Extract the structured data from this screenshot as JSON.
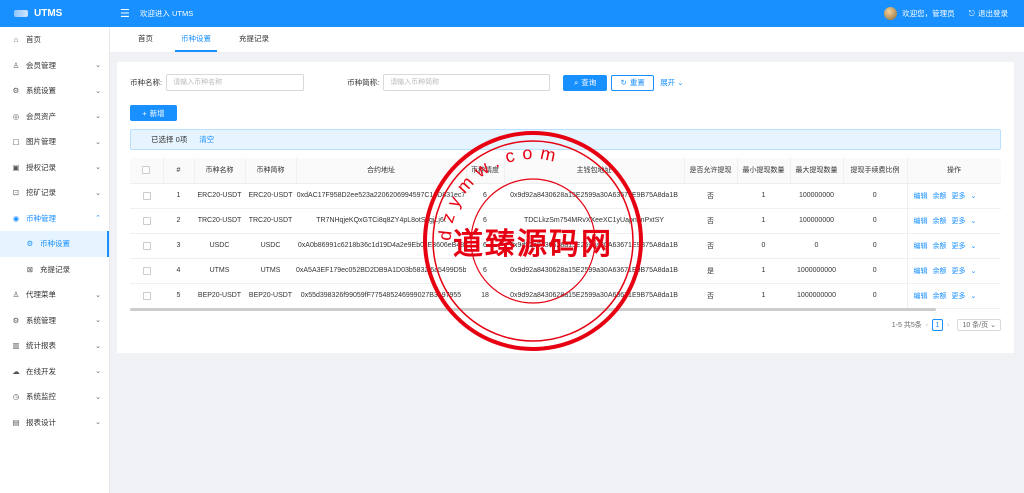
{
  "app": {
    "name": "UTMS",
    "welcome": "欢迎进入 UTMS"
  },
  "user": {
    "greeting": "欢迎您，管理员",
    "logout": "退出登录"
  },
  "sidebar": {
    "items": [
      {
        "label": "首页",
        "icon": "home-icon",
        "glyph": "⌂",
        "arrow": ""
      },
      {
        "label": "会员管理",
        "icon": "user-icon",
        "glyph": "♙",
        "arrow": "⌄"
      },
      {
        "label": "系统设置",
        "icon": "gear-icon",
        "glyph": "⚙",
        "arrow": "⌄"
      },
      {
        "label": "会员资产",
        "icon": "asset-icon",
        "glyph": "◎",
        "arrow": "⌄"
      },
      {
        "label": "图片管理",
        "icon": "image-icon",
        "glyph": "▢",
        "arrow": "⌄"
      },
      {
        "label": "授权记录",
        "icon": "picture-icon",
        "glyph": "▣",
        "arrow": "⌄"
      },
      {
        "label": "挖矿记录",
        "icon": "mining-icon",
        "glyph": "⊡",
        "arrow": "⌄"
      },
      {
        "label": "币种管理",
        "icon": "coin-icon",
        "glyph": "◉",
        "arrow": "⌃"
      },
      {
        "label": "币种设置",
        "icon": "gear-icon",
        "glyph": "⚙",
        "arrow": ""
      },
      {
        "label": "充提记录",
        "icon": "record-icon",
        "glyph": "⊠",
        "arrow": ""
      },
      {
        "label": "代理菜单",
        "icon": "agent-icon",
        "glyph": "♙",
        "arrow": "⌄"
      },
      {
        "label": "系统管理",
        "icon": "gear-icon",
        "glyph": "⚙",
        "arrow": "⌄"
      },
      {
        "label": "统计报表",
        "icon": "stats-icon",
        "glyph": "▥",
        "arrow": "⌄"
      },
      {
        "label": "在线开发",
        "icon": "cloud-icon",
        "glyph": "☁",
        "arrow": "⌄"
      },
      {
        "label": "系统监控",
        "icon": "monitor-icon",
        "glyph": "◷",
        "arrow": "⌄"
      },
      {
        "label": "报表设计",
        "icon": "chart-icon",
        "glyph": "▤",
        "arrow": "⌄"
      }
    ]
  },
  "tabs": [
    {
      "label": "首页"
    },
    {
      "label": "币种设置"
    },
    {
      "label": "充提记录"
    }
  ],
  "search": {
    "name_label": "币种名称:",
    "name_placeholder": "请输入币种名称",
    "short_label": "币种简称:",
    "short_placeholder": "请输入币种简称",
    "query_button": "查询",
    "reset_button": "重置",
    "expand": "展开"
  },
  "toolbar": {
    "add_button": "新增"
  },
  "alert": {
    "selected": "已选择 0项",
    "clear": "清空"
  },
  "table": {
    "headers": [
      "#",
      "币种名称",
      "币种简称",
      "合约地址",
      "币种精度",
      "主钱包地址",
      "是否允许提现",
      "最小提现数量",
      "最大提现数量",
      "提现手续费比例",
      "操作"
    ],
    "rows": [
      [
        "1",
        "ERC20-USDT",
        "ERC20-USDT",
        "0xdAC17F958D2ee523a2206206994597C13D831ec7",
        "6",
        "0x9d92a8430628a15E2599a30A63671E9B75A8da1B",
        "否",
        "1",
        "100000000",
        "0"
      ],
      [
        "2",
        "TRC20-USDT",
        "TRC20-USDT",
        "TR7NHqjeKQxGTCi8q8ZY4pL8otSzgjLj6t",
        "6",
        "TDCLkzSm754MRvXXeeXC1yUapndnPxtSY",
        "否",
        "1",
        "100000000",
        "0"
      ],
      [
        "3",
        "USDC",
        "USDC",
        "0xA0b86991c6218b36c1d19D4a2e9Eb0cE3606eB48",
        "6",
        "0x9d92a8430628a15E2599a30A63671E9B75A8da1B",
        "否",
        "0",
        "0",
        "0"
      ],
      [
        "4",
        "UTMS",
        "UTMS",
        "0xA5A3EF179ec052BD2DB9A1D03b5832f6a5499D5b",
        "6",
        "0x9d92a8430628a15E2599a30A63671E9B75A8da1B",
        "是",
        "1",
        "1000000000",
        "0"
      ],
      [
        "5",
        "BEP20-USDT",
        "BEP20-USDT",
        "0x55d398326f99059fF775485246999027B3197955",
        "18",
        "0x9d92a8430628a15E2599a30A63671E9B75A8da1B",
        "否",
        "1",
        "1000000000",
        "0"
      ]
    ],
    "ops": {
      "edit": "编辑",
      "balance": "余额",
      "more": "更多"
    }
  },
  "pagination": {
    "total": "1-5 共5条",
    "page": "1",
    "size": "10 条/页"
  },
  "watermark": {
    "text": "道臻源码网",
    "ring": "dzymw.com"
  },
  "colors": {
    "primary": "#1890ff",
    "stamp": "#e60012"
  }
}
